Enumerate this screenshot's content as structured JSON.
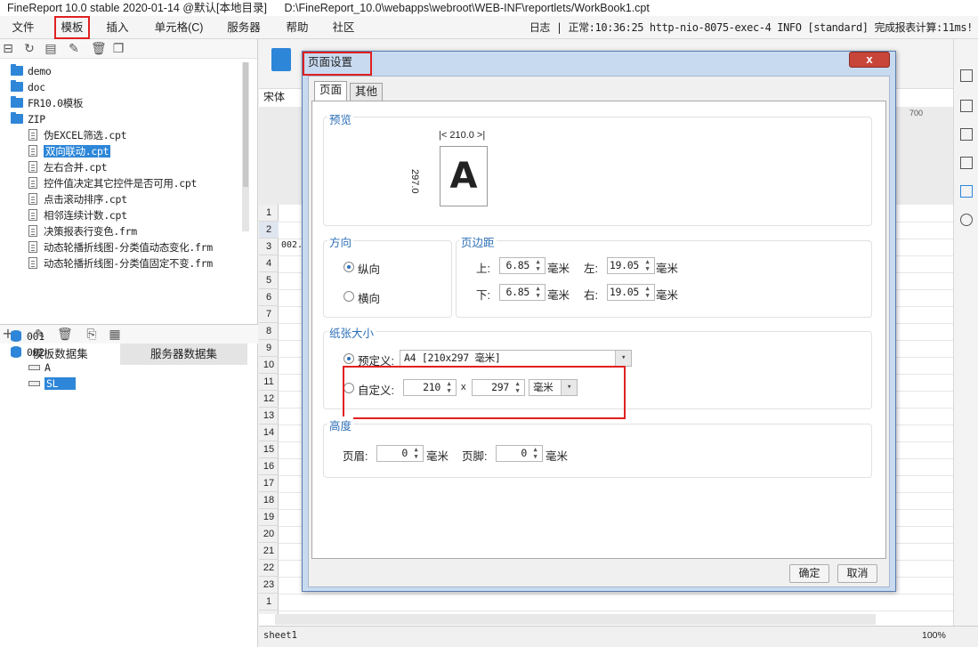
{
  "window": {
    "title": "FineReport 10.0 stable 2020-01-14 @默认[本地目录]",
    "path": "D:\\FineReport_10.0\\webapps\\webroot\\WEB-INF\\reportlets/WorkBook1.cpt"
  },
  "menu": {
    "items": [
      "文件",
      "模板",
      "插入",
      "单元格(C)",
      "服务器",
      "帮助",
      "社区"
    ],
    "status": "日志 | 正常:10:36:25 http-nio-8075-exec-4 INFO [standard] 完成报表计算:11ms!"
  },
  "tree": {
    "folders": [
      "demo",
      "doc",
      "FR10.0模板",
      "ZIP"
    ],
    "files": [
      "伪EXCEL筛选.cpt",
      "双向联动.cpt",
      "左右合并.cpt",
      "控件值决定其它控件是否可用.cpt",
      "点击滚动排序.cpt",
      "相邻连续计数.cpt",
      "决策报表行变色.frm",
      "动态轮播折线图-分类值动态变化.frm",
      "动态轮播折线图-分类值固定不变.frm"
    ]
  },
  "datasets": {
    "tabs": [
      "模板数据集",
      "服务器数据集"
    ],
    "items": [
      "001",
      "002"
    ],
    "fields": [
      "A",
      "SL"
    ]
  },
  "designer": {
    "font": "宋体",
    "ruler_mark": "700",
    "rows": [
      "1",
      "2",
      "3",
      "4",
      "5",
      "6",
      "7",
      "8",
      "9",
      "10",
      "11",
      "12",
      "13",
      "14",
      "15",
      "16",
      "17",
      "18",
      "19",
      "20",
      "21",
      "22",
      "23",
      "1"
    ],
    "cell_b2": "002.",
    "sheet": "sheet1",
    "zoom": "100%"
  },
  "dialog": {
    "title": "页面设置",
    "close": "x",
    "tabs": [
      "页面",
      "其他"
    ],
    "preview": {
      "title": "预览",
      "width_label": "210.0",
      "height_label": "297.0",
      "glyph": "A"
    },
    "orientation": {
      "title": "方向",
      "portrait": "纵向",
      "landscape": "横向",
      "selected": "portrait"
    },
    "margins": {
      "title": "页边距",
      "top_label": "上:",
      "top": "6.85",
      "left_label": "左:",
      "left": "19.05",
      "bottom_label": "下:",
      "bottom": "6.85",
      "right_label": "右:",
      "right": "19.05",
      "unit": "毫米"
    },
    "paper": {
      "title": "纸张大小",
      "preset_label": "预定义:",
      "preset_value": "A4 [210x297 毫米]",
      "custom_label": "自定义:",
      "custom_w": "210",
      "times": "x",
      "custom_h": "297",
      "custom_unit": "毫米"
    },
    "height": {
      "title": "高度",
      "header_label": "页眉:",
      "header": "0",
      "footer_label": "页脚:",
      "footer": "0",
      "unit": "毫米"
    },
    "ok": "确定",
    "cancel": "取消"
  }
}
